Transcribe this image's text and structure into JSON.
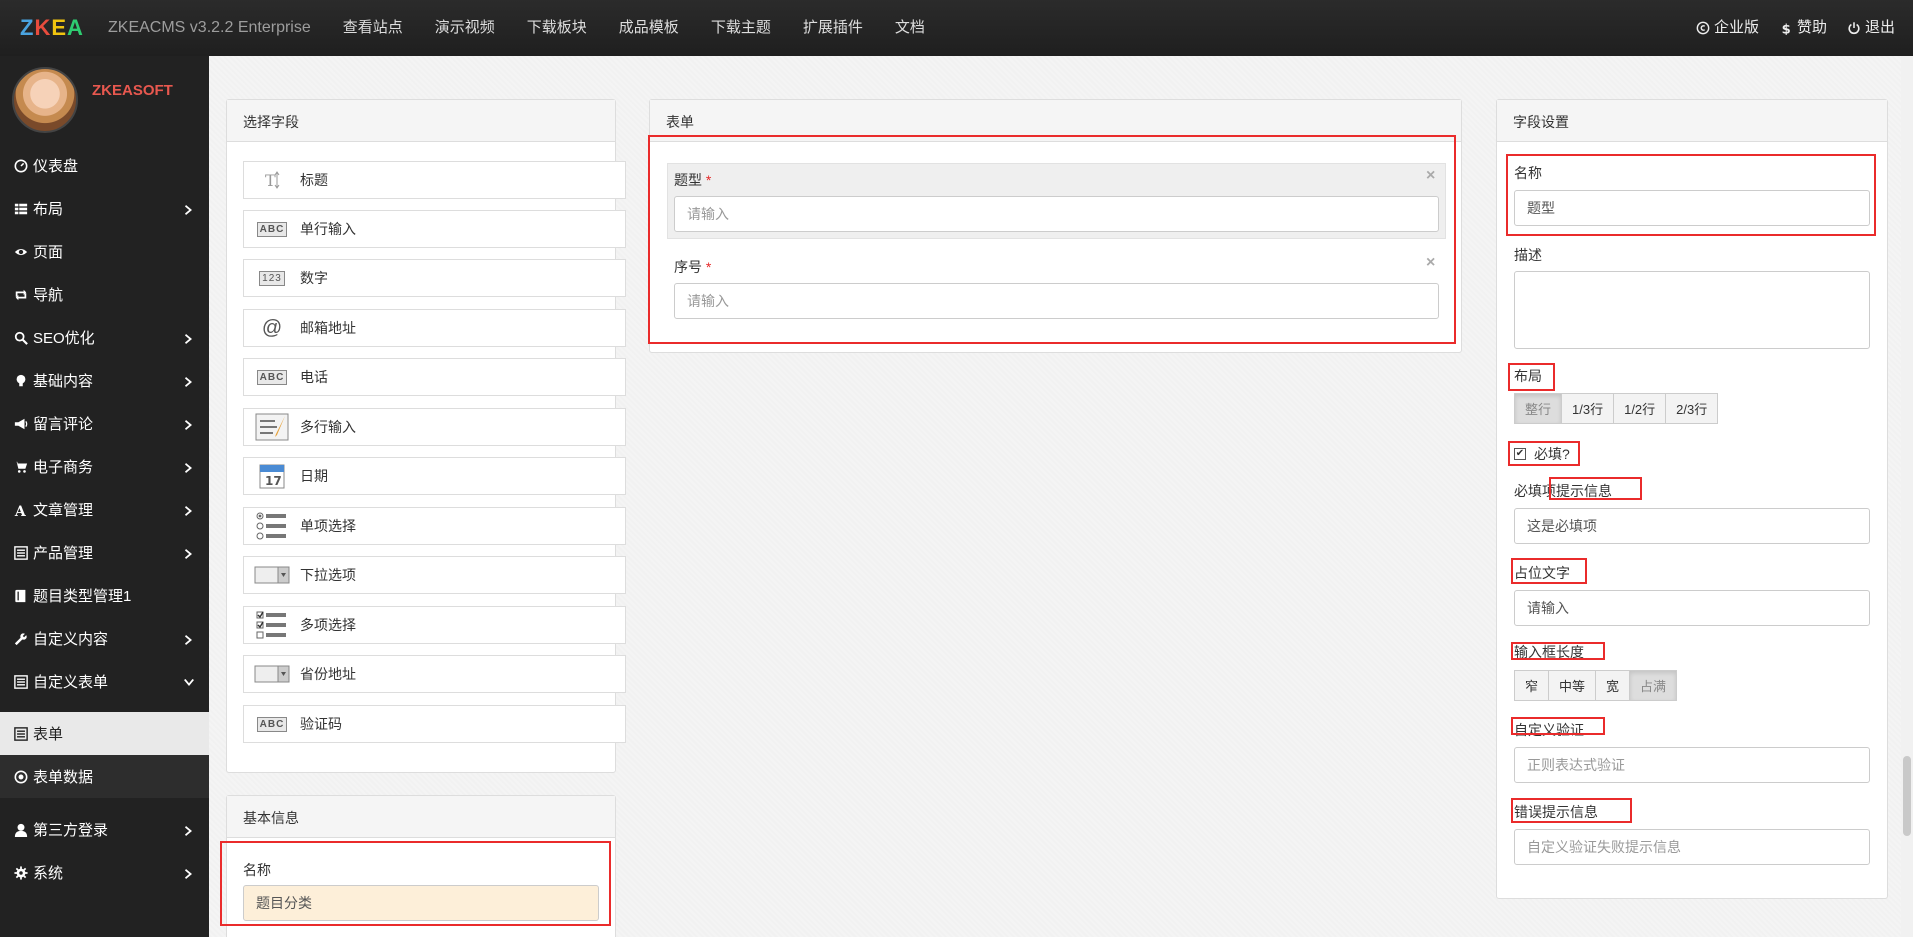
{
  "topbar": {
    "logo": {
      "z": "Z",
      "k": "K",
      "e": "E",
      "a": "A"
    },
    "brand": "ZKEACMS v3.2.2 Enterprise",
    "nav": [
      "查看站点",
      "演示视频",
      "下载板块",
      "成品模板",
      "下载主题",
      "扩展插件",
      "文档"
    ],
    "right": {
      "enterprise": "企业版",
      "donate": "赞助",
      "logout": "退出"
    }
  },
  "sidebar": {
    "username": "ZKEASOFT",
    "items": {
      "dashboard": "仪表盘",
      "layout": "布局",
      "page": "页面",
      "navigation": "导航",
      "seo": "SEO优化",
      "basic_content": "基础内容",
      "comments": "留言评论",
      "ecommerce": "电子商务",
      "articles": "文章管理",
      "products": "产品管理",
      "question_types": "题目类型管理1",
      "custom_content": "自定义内容",
      "custom_forms": "自定义表单",
      "forms": "表单",
      "form_data": "表单数据",
      "third_party_login": "第三方登录",
      "system": "系统"
    }
  },
  "select_fields": {
    "title": "选择字段",
    "items": [
      "标题",
      "单行输入",
      "数字",
      "邮箱地址",
      "电话",
      "多行输入",
      "日期",
      "单项选择",
      "下拉选项",
      "多项选择",
      "省份地址",
      "验证码"
    ]
  },
  "basic_info": {
    "title": "基本信息",
    "name_label": "名称",
    "name_value": "题目分类"
  },
  "form": {
    "title": "表单",
    "fields": [
      {
        "label": "题型",
        "required": "*",
        "placeholder": "请输入"
      },
      {
        "label": "序号",
        "required": "*",
        "placeholder": "请输入"
      }
    ],
    "close": "×"
  },
  "field_settings": {
    "title": "字段设置",
    "name_label": "名称",
    "name_value": "题型",
    "desc_label": "描述",
    "layout_label": "布局",
    "layout_options": [
      "整行",
      "1/3行",
      "1/2行",
      "2/3行"
    ],
    "required_label": "必填?",
    "required_checked": true,
    "required_msg_label": "必填项提示信息",
    "required_msg_value": "这是必填项",
    "placeholder_label": "占位文字",
    "placeholder_value": "请输入",
    "width_label": "输入框长度",
    "width_options": [
      "窄",
      "中等",
      "宽",
      "占满"
    ],
    "validation_label": "自定义验证",
    "validation_placeholder": "正则表达式验证",
    "error_label": "错误提示信息",
    "error_placeholder": "自定义验证失败提示信息"
  }
}
